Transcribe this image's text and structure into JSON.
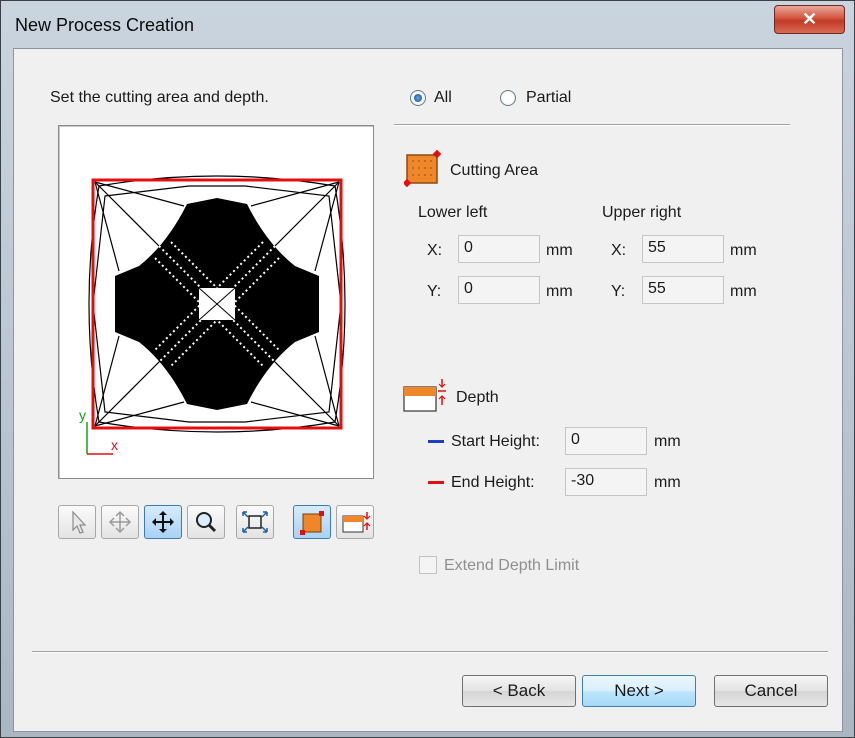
{
  "window": {
    "title": "New Process Creation",
    "close_symbol": "✕"
  },
  "instruction": "Set the cutting area and depth.",
  "area_mode": {
    "options": [
      "All",
      "Partial"
    ],
    "selected": "All"
  },
  "cutting_area": {
    "title": "Cutting Area",
    "lower_left": {
      "label": "Lower left",
      "x_label": "X:",
      "y_label": "Y:",
      "x": "0",
      "y": "0",
      "unit": "mm"
    },
    "upper_right": {
      "label": "Upper right",
      "x_label": "X:",
      "y_label": "Y:",
      "x": "55",
      "y": "55",
      "unit": "mm"
    }
  },
  "depth": {
    "title": "Depth",
    "start": {
      "label": "Start Height:",
      "value": "0",
      "unit": "mm",
      "color": "#1f3fbf"
    },
    "end": {
      "label": "End Height:",
      "value": "-30",
      "unit": "mm",
      "color": "#e01010"
    }
  },
  "extend_depth_limit": {
    "label": "Extend Depth Limit",
    "checked": false,
    "enabled": false
  },
  "preview": {
    "axis_x": "x",
    "axis_y": "y",
    "area_color": "#e01010"
  },
  "toolbar": [
    "select-icon",
    "pan-icon",
    "move-icon",
    "zoom-icon",
    "fit-icon",
    "cutting-area-icon",
    "depth-icon"
  ],
  "buttons": {
    "back": "< Back",
    "next": "Next >",
    "cancel": "Cancel"
  },
  "colors": {
    "accent": "#f0862a",
    "selection": "#3c7fb1"
  }
}
